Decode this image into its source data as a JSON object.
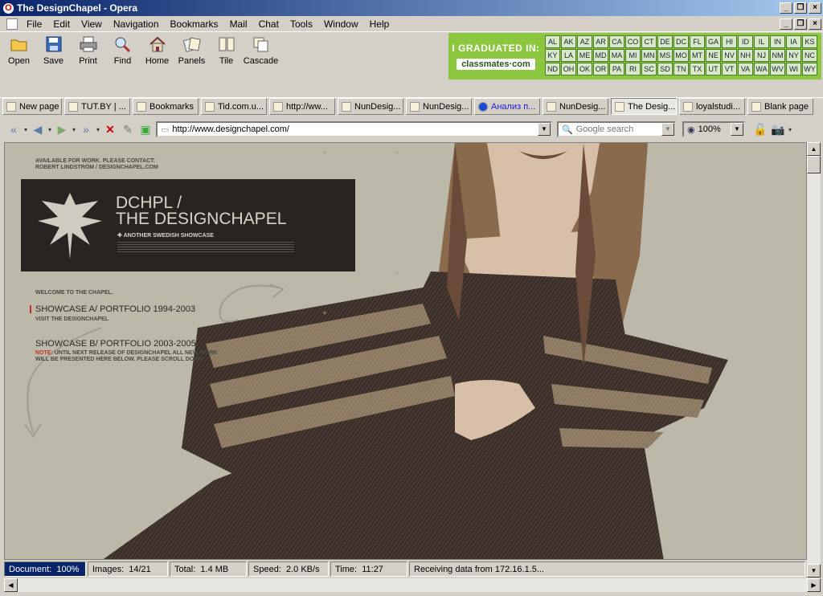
{
  "window": {
    "title": "The DesignChapel - Opera"
  },
  "menu": [
    "File",
    "Edit",
    "View",
    "Navigation",
    "Bookmarks",
    "Mail",
    "Chat",
    "Tools",
    "Window",
    "Help"
  ],
  "toolbar": [
    {
      "label": "Open",
      "icon": "folder-icon"
    },
    {
      "label": "Save",
      "icon": "floppy-icon"
    },
    {
      "label": "Print",
      "icon": "printer-icon"
    },
    {
      "label": "Find",
      "icon": "magnifier-icon"
    },
    {
      "label": "Home",
      "icon": "house-icon"
    },
    {
      "label": "Panels",
      "icon": "panels-icon"
    },
    {
      "label": "Tile",
      "icon": "tile-icon"
    },
    {
      "label": "Cascade",
      "icon": "cascade-icon"
    }
  ],
  "ad": {
    "line1": "I GRADUATED IN:",
    "line2": "classmates·com",
    "states": [
      "AL",
      "AK",
      "AZ",
      "AR",
      "CA",
      "CO",
      "CT",
      "DE",
      "DC",
      "FL",
      "GA",
      "HI",
      "ID",
      "IL",
      "IN",
      "IA",
      "KS",
      "KY",
      "LA",
      "ME",
      "MD",
      "MA",
      "MI",
      "MN",
      "MS",
      "MO",
      "MT",
      "NE",
      "NV",
      "NH",
      "NJ",
      "NM",
      "NY",
      "NC",
      "ND",
      "OH",
      "OK",
      "OR",
      "PA",
      "RI",
      "SC",
      "SD",
      "TN",
      "TX",
      "UT",
      "VT",
      "VA",
      "WA",
      "WV",
      "WI",
      "WY"
    ]
  },
  "tabs": [
    {
      "label": "New page",
      "w": 74
    },
    {
      "label": "TUT.BY | ...",
      "w": 82
    },
    {
      "label": "Bookmarks",
      "w": 82
    },
    {
      "label": "Tid.com.u...",
      "w": 82
    },
    {
      "label": "http://ww...",
      "w": 82
    },
    {
      "label": "NunDesig...",
      "w": 82
    },
    {
      "label": "NunDesig...",
      "w": 82
    },
    {
      "label": "Анализ п...",
      "w": 82
    },
    {
      "label": "NunDesig...",
      "w": 82
    },
    {
      "label": "The Desig...",
      "w": 82
    },
    {
      "label": "loyalstudi...",
      "w": 82
    },
    {
      "label": "Blank page",
      "w": 82
    }
  ],
  "address": {
    "url": "http://www.designchapel.com/",
    "search_placeholder": "Google search",
    "zoom": "100%"
  },
  "page": {
    "avail1": "AVAILABLE FOR WORK. PLEASE CONTACT:",
    "avail2": "ROBERT LINDSTRÖM / DESIGNCHAPEL.COM",
    "logo1": "DCHPL /",
    "logo2": "THE DESIGNCHAPEL",
    "logo3": "ANOTHER SWEDISH SHOWCASE",
    "welcome": "WELCOME TO THE CHAPEL.",
    "showA": "SHOWCASE A/ PORTFOLIO 1994-2003",
    "showA_sub": "VISIT THE DESIGNCHAPEL",
    "showB": "SHOWCASE B/ PORTFOLIO 2003-2005",
    "note_label": "NOTE:",
    "note1": "UNTIL NEXT RELEASE OF DESIGNCHAPEL ALL NEW WORK",
    "note2": "WILL BE PRESENTED HERE BELOW. PLEASE SCROLL DOWN ."
  },
  "status": {
    "document_label": "Document:",
    "document": "100%",
    "images_label": "Images:",
    "images": "14/21",
    "total_label": "Total:",
    "total": "1.4 MB",
    "speed_label": "Speed:",
    "speed": "2.0 KB/s",
    "time_label": "Time:",
    "time": "11:27",
    "message": "Receiving data from 172.16.1.5..."
  }
}
